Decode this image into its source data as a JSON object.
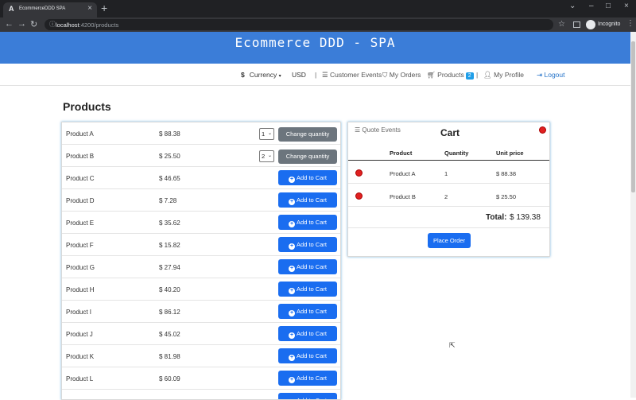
{
  "browser": {
    "tab_title": "EcommerceDDD SPA",
    "url_host": "localhost",
    "url_path": ":4200/products",
    "profile_label": "Incognito"
  },
  "app": {
    "title": "Ecommerce DDD - SPA"
  },
  "navbar": {
    "currency_label": "Currency",
    "currency_value": "USD",
    "customer_events": "Customer Events",
    "my_orders": "My Orders",
    "products": "Products",
    "products_badge": "2",
    "my_profile": "My Profile",
    "logout": "Logout",
    "separator": "|"
  },
  "page": {
    "title": "Products"
  },
  "products": [
    {
      "name": "Product A",
      "price": "$ 88.38",
      "in_cart": true,
      "qty": "1",
      "action": "Change quantity"
    },
    {
      "name": "Product B",
      "price": "$ 25.50",
      "in_cart": true,
      "qty": "2",
      "action": "Change quantity"
    },
    {
      "name": "Product C",
      "price": "$ 46.65",
      "in_cart": false,
      "action": "Add to Cart"
    },
    {
      "name": "Product D",
      "price": "$ 7.28",
      "in_cart": false,
      "action": "Add to Cart"
    },
    {
      "name": "Product E",
      "price": "$ 35.62",
      "in_cart": false,
      "action": "Add to Cart"
    },
    {
      "name": "Product F",
      "price": "$ 15.82",
      "in_cart": false,
      "action": "Add to Cart"
    },
    {
      "name": "Product G",
      "price": "$ 27.94",
      "in_cart": false,
      "action": "Add to Cart"
    },
    {
      "name": "Product H",
      "price": "$ 40.20",
      "in_cart": false,
      "action": "Add to Cart"
    },
    {
      "name": "Product I",
      "price": "$ 86.12",
      "in_cart": false,
      "action": "Add to Cart"
    },
    {
      "name": "Product J",
      "price": "$ 45.02",
      "in_cart": false,
      "action": "Add to Cart"
    },
    {
      "name": "Product K",
      "price": "$ 81.98",
      "in_cart": false,
      "action": "Add to Cart"
    },
    {
      "name": "Product L",
      "price": "$ 60.09",
      "in_cart": false,
      "action": "Add to Cart"
    },
    {
      "name": "",
      "price": "",
      "in_cart": false,
      "action": "Add to Cart"
    }
  ],
  "cart": {
    "quote_events": "Quote Events",
    "title": "Cart",
    "headers": {
      "product": "Product",
      "quantity": "Quantity",
      "unit_price": "Unit price"
    },
    "items": [
      {
        "product": "Product A",
        "quantity": "1",
        "unit_price": "$ 88.38"
      },
      {
        "product": "Product B",
        "quantity": "2",
        "unit_price": "$ 25.50"
      }
    ],
    "total_label": "Total:",
    "total_value": "$ 139.38",
    "place_order": "Place Order"
  },
  "colors": {
    "banner": "#3b7dd8",
    "primary": "#1a6df0",
    "secondary": "#6c757d",
    "danger": "#e02020",
    "badge": "#1f9ee8"
  }
}
